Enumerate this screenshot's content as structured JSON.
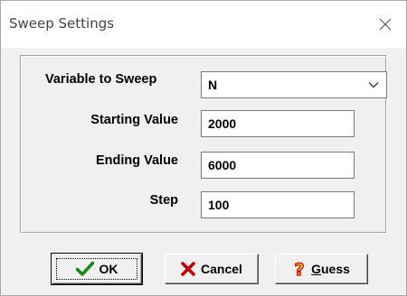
{
  "window": {
    "title": "Sweep Settings",
    "close_icon": "close-icon"
  },
  "form": {
    "variable_label": "Variable to Sweep",
    "variable_value": "N",
    "start_label": "Starting Value",
    "start_value": "2000",
    "end_label": "Ending Value",
    "end_value": "6000",
    "step_label": "Step",
    "step_value": "100"
  },
  "buttons": {
    "ok_label": "OK",
    "ok_icon": "checkmark-icon",
    "cancel_label": "Cancel",
    "cancel_icon": "x-icon",
    "guess_label": "Guess",
    "guess_icon": "question-icon"
  },
  "colors": {
    "ok_check": "#1a8a1a",
    "cancel_x": "#c00000",
    "guess_q_fill": "#f5d000",
    "guess_q_stroke": "#c00000"
  }
}
